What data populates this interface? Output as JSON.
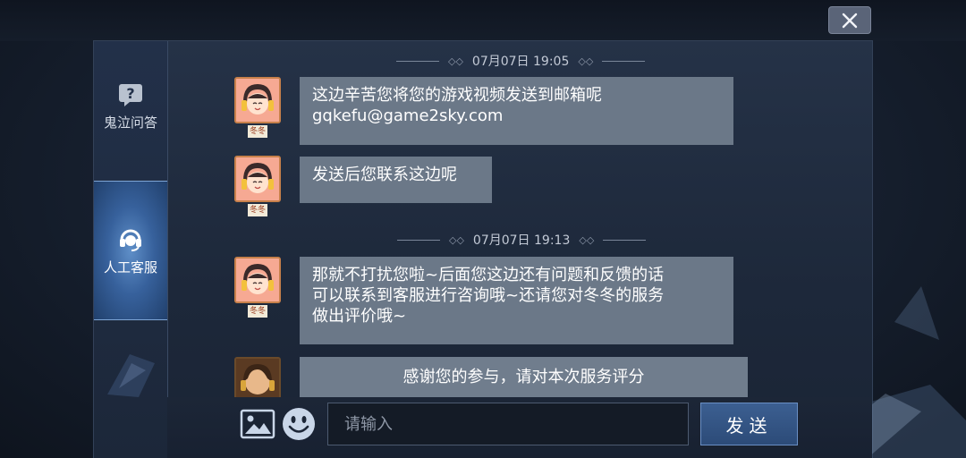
{
  "window": {
    "close_icon": "close-icon"
  },
  "sidebar": {
    "items": [
      {
        "label": "鬼泣问答",
        "icon": "question-bubble-icon",
        "active": false
      },
      {
        "label": "人工客服",
        "icon": "headset-icon",
        "active": true
      }
    ]
  },
  "chat": {
    "agent_name": "冬冬",
    "messages": [
      {
        "type": "timestamp",
        "text": "07月07日 19:05"
      },
      {
        "type": "agent",
        "lines": [
          "这边辛苦您将您的游戏视频发送到邮箱呢",
          "gqkefu@game2sky.com"
        ]
      },
      {
        "type": "agent",
        "lines": [
          "发送后您联系这边呢"
        ]
      },
      {
        "type": "timestamp",
        "text": "07月07日 19:13"
      },
      {
        "type": "agent",
        "lines": [
          "那就不打扰您啦~后面您这边还有问题和反馈的话",
          "可以联系到客服进行咨询哦~还请您对冬冬的服务",
          "做出评价哦~"
        ]
      },
      {
        "type": "rating",
        "text": "感谢您的参与，请对本次服务评分"
      }
    ]
  },
  "input": {
    "placeholder": "请输入",
    "value": "",
    "send_label": "发送",
    "image_icon": "image-icon",
    "emoji_icon": "emoji-icon"
  },
  "colors": {
    "bubble": "#6b7888",
    "active_tab": "#37619c",
    "send_button": "#2c4b78"
  }
}
